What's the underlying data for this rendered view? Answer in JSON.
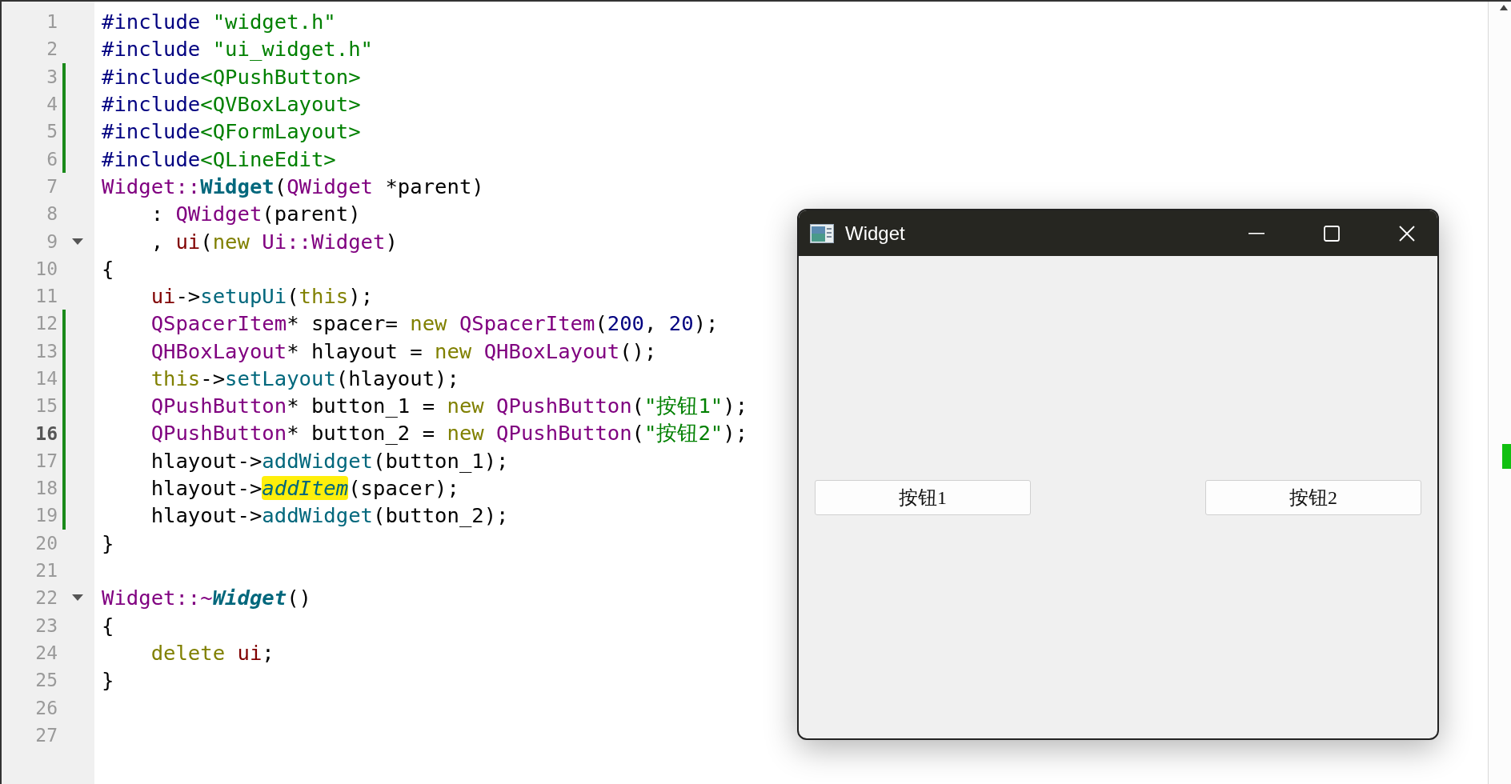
{
  "editor": {
    "lines": [
      {
        "number": "1",
        "current": false,
        "changed": false,
        "tokens": [
          {
            "kind": "pre",
            "text": "#include "
          },
          {
            "kind": "str",
            "text": "\"widget.h\""
          }
        ]
      },
      {
        "number": "2",
        "current": false,
        "changed": false,
        "tokens": [
          {
            "kind": "pre",
            "text": "#include "
          },
          {
            "kind": "str",
            "text": "\"ui_widget.h\""
          }
        ]
      },
      {
        "number": "3",
        "current": false,
        "changed": true,
        "tokens": [
          {
            "kind": "pre",
            "text": "#include"
          },
          {
            "kind": "str",
            "text": "<QPushButton>"
          }
        ]
      },
      {
        "number": "4",
        "current": false,
        "changed": true,
        "tokens": [
          {
            "kind": "pre",
            "text": "#include"
          },
          {
            "kind": "str",
            "text": "<QVBoxLayout>"
          }
        ]
      },
      {
        "number": "5",
        "current": false,
        "changed": true,
        "tokens": [
          {
            "kind": "pre",
            "text": "#include"
          },
          {
            "kind": "str",
            "text": "<QFormLayout>"
          }
        ]
      },
      {
        "number": "6",
        "current": false,
        "changed": true,
        "tokens": [
          {
            "kind": "pre",
            "text": "#include"
          },
          {
            "kind": "str",
            "text": "<QLineEdit>"
          }
        ]
      },
      {
        "number": "7",
        "current": false,
        "changed": false,
        "tokens": [
          {
            "kind": "type",
            "text": "Widget::"
          },
          {
            "kind": "decl",
            "text": "Widget"
          },
          {
            "kind": "plain",
            "text": "("
          },
          {
            "kind": "type",
            "text": "QWidget"
          },
          {
            "kind": "plain",
            "text": " *parent)"
          }
        ]
      },
      {
        "number": "8",
        "current": false,
        "changed": false,
        "tokens": [
          {
            "kind": "plain",
            "text": "    : "
          },
          {
            "kind": "type",
            "text": "QWidget"
          },
          {
            "kind": "plain",
            "text": "(parent)"
          }
        ]
      },
      {
        "number": "9",
        "current": false,
        "changed": false,
        "fold_expanded": true,
        "tokens": [
          {
            "kind": "plain",
            "text": "    , "
          },
          {
            "kind": "member",
            "text": "ui"
          },
          {
            "kind": "plain",
            "text": "("
          },
          {
            "kind": "kw",
            "text": "new "
          },
          {
            "kind": "type",
            "text": "Ui::Widget"
          },
          {
            "kind": "plain",
            "text": ")"
          }
        ]
      },
      {
        "number": "10",
        "current": false,
        "changed": false,
        "tokens": [
          {
            "kind": "plain",
            "text": "{"
          }
        ]
      },
      {
        "number": "11",
        "current": false,
        "changed": false,
        "tokens": [
          {
            "kind": "member",
            "text": "    ui"
          },
          {
            "kind": "plain",
            "text": "->"
          },
          {
            "kind": "fn",
            "text": "setupUi"
          },
          {
            "kind": "plain",
            "text": "("
          },
          {
            "kind": "kw",
            "text": "this"
          },
          {
            "kind": "plain",
            "text": ");"
          }
        ]
      },
      {
        "number": "12",
        "current": false,
        "changed": true,
        "tokens": [
          {
            "kind": "type",
            "text": "    QSpacerItem"
          },
          {
            "kind": "plain",
            "text": "* spacer= "
          },
          {
            "kind": "kw",
            "text": "new "
          },
          {
            "kind": "type",
            "text": "QSpacerItem"
          },
          {
            "kind": "plain",
            "text": "("
          },
          {
            "kind": "num",
            "text": "200"
          },
          {
            "kind": "plain",
            "text": ", "
          },
          {
            "kind": "num",
            "text": "20"
          },
          {
            "kind": "plain",
            "text": ");"
          }
        ]
      },
      {
        "number": "13",
        "current": false,
        "changed": true,
        "tokens": [
          {
            "kind": "type",
            "text": "    QHBoxLayout"
          },
          {
            "kind": "plain",
            "text": "* hlayout = "
          },
          {
            "kind": "kw",
            "text": "new "
          },
          {
            "kind": "type",
            "text": "QHBoxLayout"
          },
          {
            "kind": "plain",
            "text": "();"
          }
        ]
      },
      {
        "number": "14",
        "current": false,
        "changed": true,
        "tokens": [
          {
            "kind": "kw",
            "text": "    this"
          },
          {
            "kind": "plain",
            "text": "->"
          },
          {
            "kind": "fn",
            "text": "setLayout"
          },
          {
            "kind": "plain",
            "text": "(hlayout);"
          }
        ]
      },
      {
        "number": "15",
        "current": false,
        "changed": true,
        "tokens": [
          {
            "kind": "type",
            "text": "    QPushButton"
          },
          {
            "kind": "plain",
            "text": "* button_1 = "
          },
          {
            "kind": "kw",
            "text": "new "
          },
          {
            "kind": "type",
            "text": "QPushButton"
          },
          {
            "kind": "plain",
            "text": "("
          },
          {
            "kind": "str",
            "text": "\"按钮1\""
          },
          {
            "kind": "plain",
            "text": ");"
          }
        ]
      },
      {
        "number": "16",
        "current": true,
        "changed": true,
        "tokens": [
          {
            "kind": "type",
            "text": "    QPushButton"
          },
          {
            "kind": "plain",
            "text": "* button_2 = "
          },
          {
            "kind": "kw",
            "text": "new "
          },
          {
            "kind": "type",
            "text": "QPushButton"
          },
          {
            "kind": "plain",
            "text": "("
          },
          {
            "kind": "str",
            "text": "\"按钮2\""
          },
          {
            "kind": "plain",
            "text": ");"
          }
        ]
      },
      {
        "number": "17",
        "current": false,
        "changed": true,
        "tokens": [
          {
            "kind": "plain",
            "text": "    hlayout->"
          },
          {
            "kind": "fn",
            "text": "addWidget"
          },
          {
            "kind": "plain",
            "text": "(button_1);"
          }
        ]
      },
      {
        "number": "18",
        "current": false,
        "changed": true,
        "tokens": [
          {
            "kind": "plain",
            "text": "    hlayout->"
          },
          {
            "kind": "fn_italic",
            "text": "addItem",
            "highlighted": true
          },
          {
            "kind": "plain",
            "text": "(spacer);"
          }
        ]
      },
      {
        "number": "19",
        "current": false,
        "changed": true,
        "tokens": [
          {
            "kind": "plain",
            "text": "    hlayout->"
          },
          {
            "kind": "fn",
            "text": "addWidget"
          },
          {
            "kind": "plain",
            "text": "(button_2);"
          }
        ]
      },
      {
        "number": "20",
        "current": false,
        "changed": false,
        "tokens": [
          {
            "kind": "plain",
            "text": "}"
          }
        ]
      },
      {
        "number": "21",
        "current": false,
        "changed": false
      },
      {
        "number": "22",
        "current": false,
        "changed": false,
        "fold_expanded": true,
        "tokens": [
          {
            "kind": "type",
            "text": "Widget::~"
          },
          {
            "kind": "decl_italic",
            "text": "Widget"
          },
          {
            "kind": "plain",
            "text": "()"
          }
        ]
      },
      {
        "number": "23",
        "current": false,
        "changed": false,
        "tokens": [
          {
            "kind": "plain",
            "text": "{"
          }
        ]
      },
      {
        "number": "24",
        "current": false,
        "changed": false,
        "tokens": [
          {
            "kind": "kw",
            "text": "    delete "
          },
          {
            "kind": "member",
            "text": "ui"
          },
          {
            "kind": "plain",
            "text": ";"
          }
        ]
      },
      {
        "number": "25",
        "current": false,
        "changed": false,
        "tokens": [
          {
            "kind": "plain",
            "text": "}"
          }
        ]
      },
      {
        "number": "26",
        "current": false,
        "changed": false
      },
      {
        "number": "27",
        "current": false,
        "changed": false
      }
    ]
  },
  "window": {
    "title": "Widget",
    "buttons": [
      {
        "label": "按钮1"
      },
      {
        "label": "按钮2"
      }
    ]
  }
}
